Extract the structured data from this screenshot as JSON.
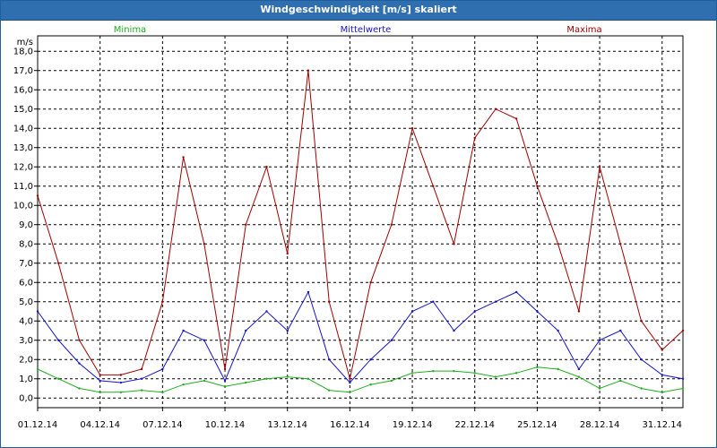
{
  "window": {
    "title": "Windgeschwindigkeit [m/s] skaliert"
  },
  "chart_data": {
    "type": "line",
    "title": "Windgeschwindigkeit [m/s] skaliert",
    "ylabel": "m/s",
    "ylim": [
      -0.5,
      18.8
    ],
    "yticks": [
      "0,0",
      "1,0",
      "2,0",
      "3,0",
      "4,0",
      "5,0",
      "6,0",
      "7,0",
      "8,0",
      "9,0",
      "10,0",
      "11,0",
      "12,0",
      "13,0",
      "14,0",
      "15,0",
      "16,0",
      "17,0",
      "18,0"
    ],
    "xticks": [
      "01.12.14",
      "04.12.14",
      "07.12.14",
      "10.12.14",
      "13.12.14",
      "16.12.14",
      "19.12.14",
      "22.12.14",
      "25.12.14",
      "28.12.14",
      "31.12.14"
    ],
    "grid": true,
    "legend": "top",
    "colors": {
      "Minima": "#1fae1f",
      "Mittelwerte": "#1414c8",
      "Maxima": "#a00000"
    },
    "x": [
      "01.12",
      "02.12",
      "03.12",
      "04.12",
      "05.12",
      "06.12",
      "07.12",
      "08.12",
      "09.12",
      "10.12",
      "11.12",
      "12.12",
      "13.12",
      "14.12",
      "15.12",
      "16.12",
      "17.12",
      "18.12",
      "19.12",
      "20.12",
      "21.12",
      "22.12",
      "23.12",
      "24.12",
      "25.12",
      "26.12",
      "27.12",
      "28.12",
      "29.12",
      "30.12",
      "31.12",
      "01.01"
    ],
    "series": [
      {
        "name": "Minima",
        "values": [
          1.5,
          1.0,
          0.5,
          0.3,
          0.3,
          0.4,
          0.3,
          0.7,
          0.9,
          0.6,
          0.8,
          1.0,
          1.1,
          1.0,
          0.4,
          0.3,
          0.7,
          0.9,
          1.3,
          1.4,
          1.4,
          1.3,
          1.1,
          1.3,
          1.6,
          1.5,
          1.1,
          0.5,
          0.9,
          0.5,
          0.3,
          0.5
        ]
      },
      {
        "name": "Mittelwerte",
        "values": [
          4.5,
          3.0,
          1.8,
          0.9,
          0.8,
          1.0,
          1.5,
          3.5,
          3.0,
          0.9,
          3.5,
          4.5,
          3.5,
          5.5,
          2.0,
          0.8,
          2.0,
          3.0,
          4.5,
          5.0,
          3.5,
          4.5,
          5.0,
          5.5,
          4.5,
          3.5,
          1.5,
          3.0,
          3.5,
          2.0,
          1.2,
          1.0
        ]
      },
      {
        "name": "Maxima",
        "values": [
          10.5,
          7.0,
          3.0,
          1.2,
          1.2,
          1.5,
          5.0,
          12.5,
          8.0,
          1.5,
          9.0,
          12.0,
          7.5,
          17.0,
          5.0,
          1.0,
          6.0,
          9.0,
          14.0,
          11.0,
          8.0,
          13.5,
          15.0,
          14.5,
          11.0,
          8.0,
          4.5,
          12.0,
          8.0,
          4.0,
          2.5,
          3.5
        ]
      }
    ]
  }
}
